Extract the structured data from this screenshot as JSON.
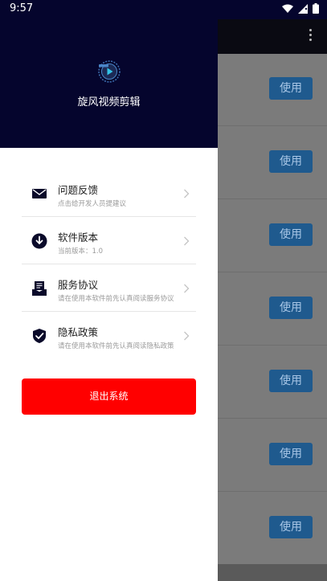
{
  "status_bar": {
    "time": "9:57"
  },
  "drawer": {
    "app_name": "旋风视频剪辑",
    "menu": [
      {
        "title": "问题反馈",
        "subtitle": "点击给开发人员提建议",
        "icon": "mail-icon"
      },
      {
        "title": "软件版本",
        "subtitle": "当前版本：1.0",
        "icon": "download-icon"
      },
      {
        "title": "服务协议",
        "subtitle": "请在使用本软件前先认真阅读服务协议",
        "icon": "document-icon"
      },
      {
        "title": "隐私政策",
        "subtitle": "请在使用本软件前先认真阅读隐私政策",
        "icon": "shield-check-icon"
      }
    ],
    "logout_label": "退出系统"
  },
  "background_list": {
    "use_button_label": "使用"
  },
  "colors": {
    "drawer_header": "#05052d",
    "logout": "#ff0000",
    "use_button": "#1f5a8e"
  }
}
